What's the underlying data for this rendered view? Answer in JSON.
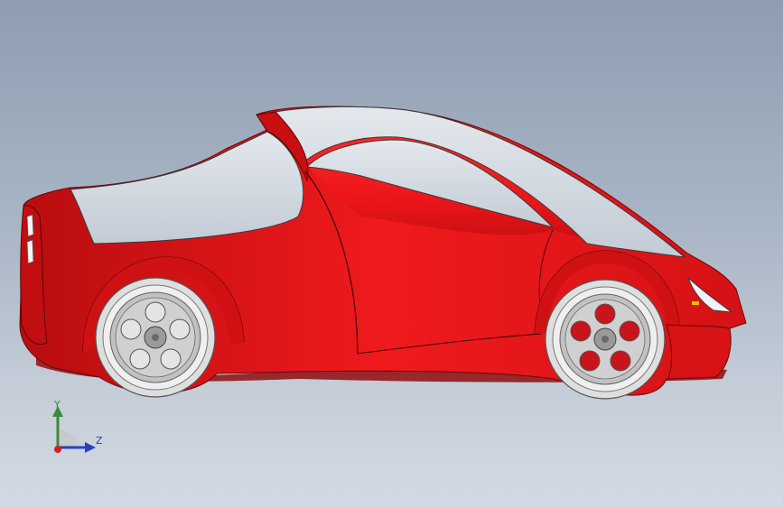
{
  "viewport": {
    "background_top": "#8e9db1",
    "background_bottom": "#d3dae3"
  },
  "model": {
    "body_color": "#e8161a",
    "body_shadow_color": "#a80c0f",
    "glass_color": "#d4dbe3",
    "rim_color": "#c9c9c9",
    "tire_color": "#e4e4e4"
  },
  "triad": {
    "y_label": "Y",
    "z_label": "Z",
    "y_color": "#3a8a3a",
    "z_color": "#2b3fc4",
    "x_color": "#d02020"
  }
}
